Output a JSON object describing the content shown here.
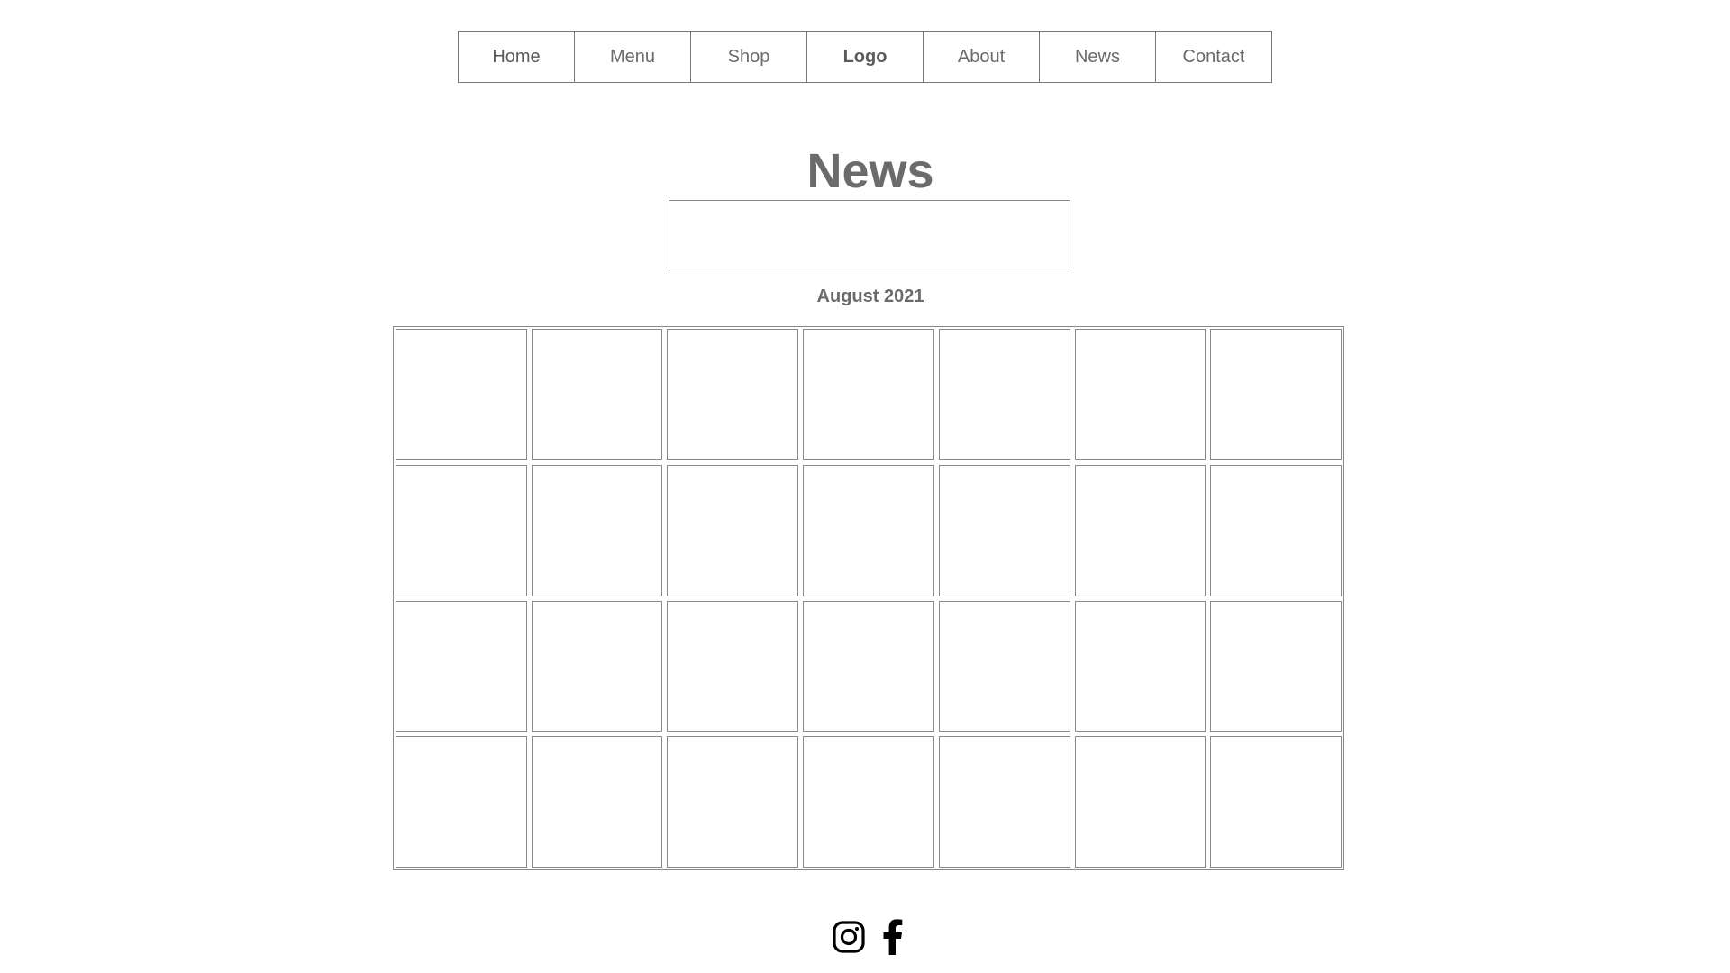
{
  "nav": {
    "items": [
      {
        "label": "Home"
      },
      {
        "label": "Menu"
      },
      {
        "label": "Shop"
      },
      {
        "label": "Logo"
      },
      {
        "label": "About"
      },
      {
        "label": "News"
      },
      {
        "label": "Contact"
      }
    ]
  },
  "page": {
    "title": "News",
    "month": "August 2021"
  },
  "calendar": {
    "rows": 4,
    "columns": 7
  },
  "social": {
    "icons": [
      "instagram-icon",
      "facebook-icon"
    ]
  },
  "colors": {
    "text": "#6b6b6b",
    "border": "#8a8a8a",
    "icon": "#000000"
  }
}
